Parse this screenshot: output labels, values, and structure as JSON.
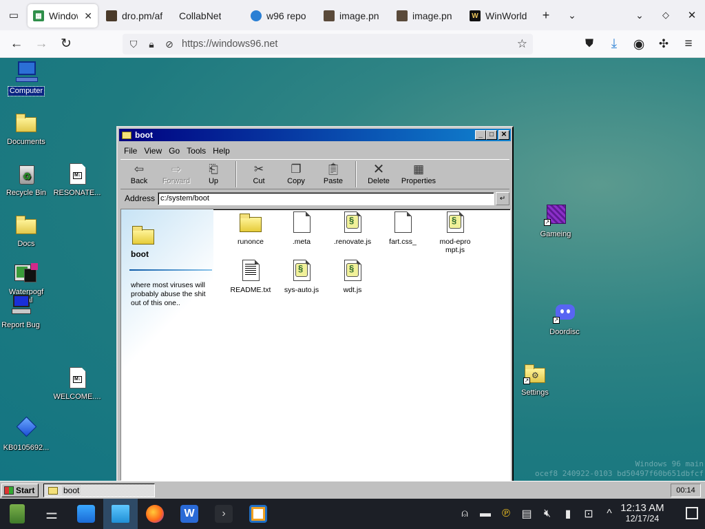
{
  "browser": {
    "tabs": [
      {
        "label": "Window",
        "favicon_color": "#2f8f4a",
        "active": true
      },
      {
        "label": "dro.pm/af",
        "favicon_color": "#4a3a2a",
        "active": false
      },
      {
        "label": "CollabNet",
        "favicon_color": "",
        "active": false
      },
      {
        "label": "w96 repo",
        "favicon_color": "#2a7fd4",
        "active": false
      },
      {
        "label": "image.pn",
        "favicon_color": "#5a4a3a",
        "active": false
      },
      {
        "label": "image.pn",
        "favicon_color": "#5a4a3a",
        "active": false
      },
      {
        "label": "WinWorld",
        "favicon_color": "#111111",
        "active": false
      }
    ],
    "url": "https://windows96.net"
  },
  "desktop": {
    "icons": [
      {
        "label": "Computer",
        "selected": true
      },
      {
        "label": "Documents"
      },
      {
        "label": "Recycle Bin"
      },
      {
        "label": "RESONATE..."
      },
      {
        "label": "Docs"
      },
      {
        "label": "Waterpogf"
      },
      {
        "label": "nal"
      },
      {
        "label": "Report Bug"
      },
      {
        "label": "WELCOME...."
      },
      {
        "label": "KB0105692..."
      },
      {
        "label": "Gameing"
      },
      {
        "label": "Doordisc"
      },
      {
        "label": "Settings"
      }
    ],
    "watermark_line1": "Windows 96 main",
    "watermark_line2": "ocef8 240922-0103 bd50497f60b651dbfcf"
  },
  "window": {
    "title": "boot",
    "menu": [
      "File",
      "View",
      "Go",
      "Tools",
      "Help"
    ],
    "toolbar": {
      "back": "Back",
      "forward": "Forward",
      "up": "Up",
      "cut": "Cut",
      "copy": "Copy",
      "paste": "Paste",
      "delete": "Delete",
      "properties": "Properties"
    },
    "address_label": "Address",
    "address_value": "c:/system/boot",
    "side_title": "boot",
    "side_desc": "where most viruses will probably abuse the shit out of this one..",
    "files": [
      {
        "name": "runonce",
        "type": "folder"
      },
      {
        "name": ".meta",
        "type": "file"
      },
      {
        "name": ".renovate.js",
        "type": "script"
      },
      {
        "name": "fart.css_",
        "type": "file"
      },
      {
        "name": "mod-eprompt.js",
        "type": "script"
      },
      {
        "name": "README.txt",
        "type": "text"
      },
      {
        "name": "sys-auto.js",
        "type": "script"
      },
      {
        "name": "wdt.js",
        "type": "script"
      }
    ]
  },
  "w96_taskbar": {
    "start_label": "Start",
    "task_label": "boot",
    "clock": "00:14"
  },
  "os_taskbar": {
    "time": "12:13 AM",
    "date": "12/17/24"
  }
}
